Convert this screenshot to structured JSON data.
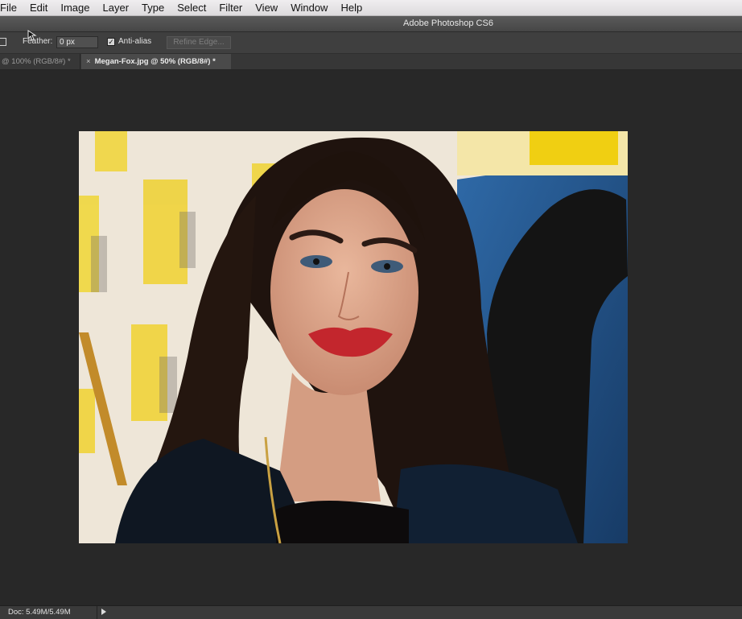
{
  "menu": {
    "items": [
      "File",
      "Edit",
      "Image",
      "Layer",
      "Type",
      "Select",
      "Filter",
      "View",
      "Window",
      "Help"
    ]
  },
  "app": {
    "title": "Adobe Photoshop CS6"
  },
  "options": {
    "feather_label": "Feather:",
    "feather_value": "0 px",
    "antialias_label": "Anti-alias",
    "antialias_checked": true,
    "refine_edge_label": "Refine Edge..."
  },
  "tabs": {
    "inactive_label": "@ 100% (RGB/8#) *",
    "active_label": "Megan-Fox.jpg @ 50% (RGB/8#) *",
    "close_glyph": "×"
  },
  "status": {
    "doc_size": "Doc: 5.49M/5.49M"
  },
  "icons": {
    "marquee_tool": "marquee-tool-icon",
    "checkbox": "checkmark-icon",
    "status_menu": "triangle-right-icon",
    "cursor": "mouse-pointer-icon"
  },
  "colors": {
    "canvas_bg": "#282828",
    "panel_bg": "#3f3f3f"
  }
}
